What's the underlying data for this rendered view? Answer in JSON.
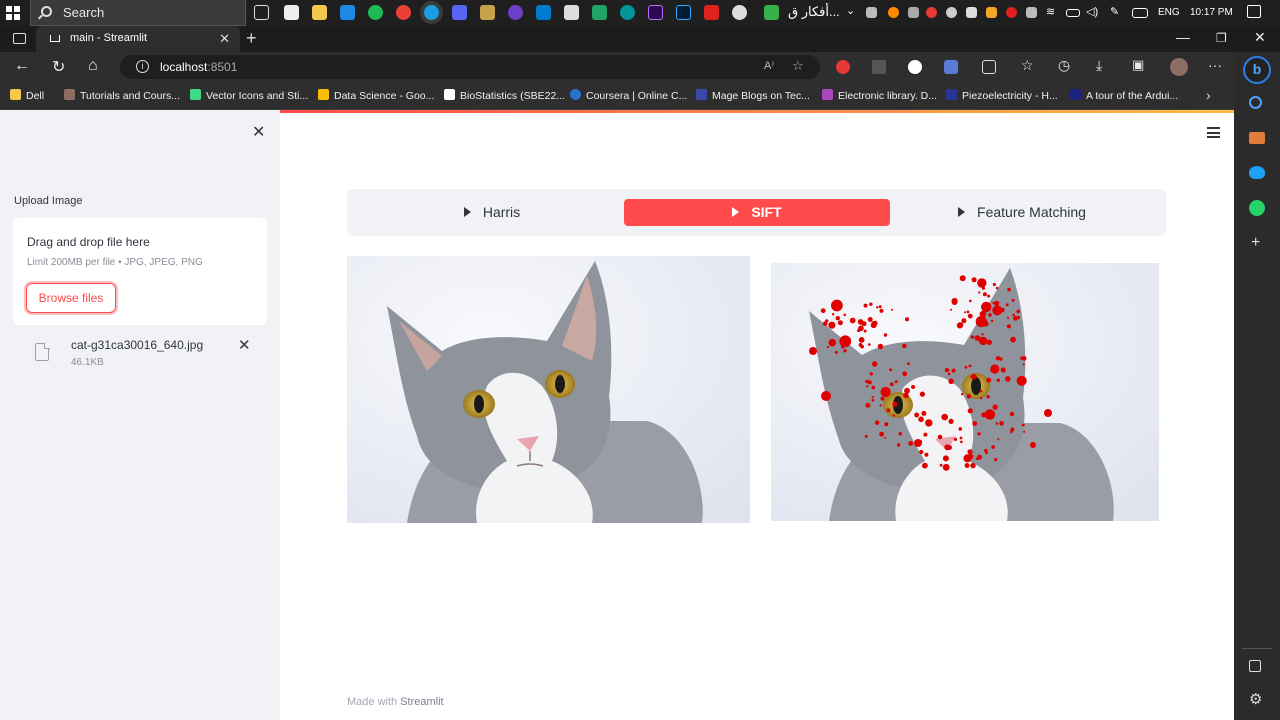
{
  "taskbar": {
    "search_placeholder": "Search",
    "arabic_label": "أفكار ق...",
    "language": "ENG",
    "time": "10:17 PM"
  },
  "browser": {
    "tab_title": "main - Streamlit",
    "url_host": "localhost",
    "url_port": ":8501",
    "bookmarks": [
      "Dell",
      "Tutorials and Cours...",
      "Vector Icons and Sti...",
      "Data Science - Goo...",
      "BioStatistics (SBE22...",
      "Coursera | Online C...",
      "Mage Blogs on Tec...",
      "Electronic library. D...",
      "Piezoelectricity - H...",
      "A tour of the Ardui..."
    ]
  },
  "sidebar": {
    "upload_label": "Upload Image",
    "dropzone_title": "Drag and drop file here",
    "dropzone_limit": "Limit 200MB per file • JPG, JPEG, PNG",
    "browse_label": "Browse files",
    "file_name": "cat-g31ca30016_640.jpg",
    "file_size": "46.1KB"
  },
  "main": {
    "tabs": [
      {
        "label": "Harris",
        "active": false
      },
      {
        "label": "SIFT",
        "active": true
      },
      {
        "label": "Feature Matching",
        "active": false
      }
    ],
    "footer_prefix": "Made with ",
    "footer_brand": "Streamlit"
  },
  "colors": {
    "accent": "#ff4b4b",
    "sidebar_bg": "#f0f2f6",
    "keypoint": "#e00000"
  }
}
